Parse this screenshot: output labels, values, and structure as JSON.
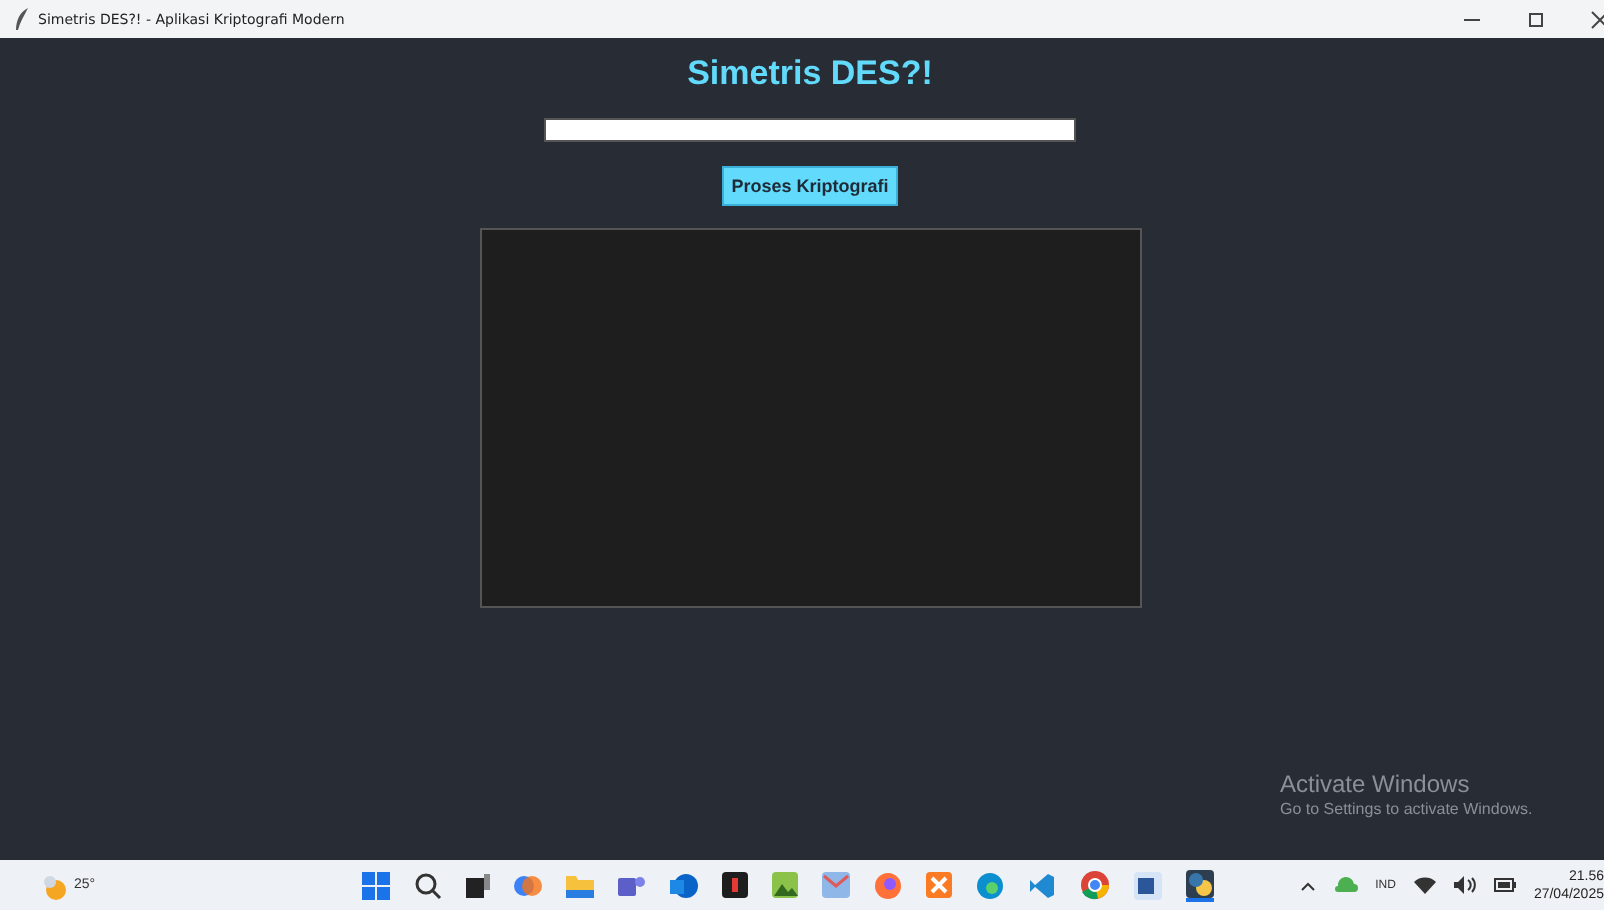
{
  "window": {
    "title": "Simetris DES?! - Aplikasi Kriptografi Modern"
  },
  "app": {
    "heading": "Simetris DES?!",
    "button": "Proses Kriptografi"
  },
  "activation_notice": {
    "title": "Activate Windows",
    "message": "Go to Settings to activate Windows."
  },
  "taskbar": {
    "weather": "25°",
    "language": "IND",
    "time": "21.56",
    "date": "27/04/2025"
  }
}
